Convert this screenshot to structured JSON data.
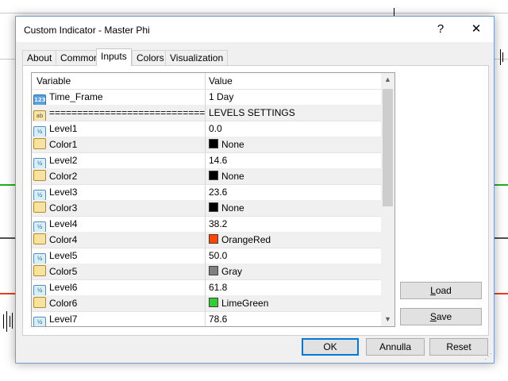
{
  "window": {
    "title": "Custom Indicator - Master Phi",
    "help_glyph": "?",
    "close_glyph": "✕",
    "accent": "#7a9cc6"
  },
  "tabs": [
    {
      "label": "About",
      "active": false
    },
    {
      "label": "Common",
      "active": false
    },
    {
      "label": "Inputs",
      "active": true
    },
    {
      "label": "Colors",
      "active": false
    },
    {
      "label": "Visualization",
      "active": false
    }
  ],
  "grid": {
    "col_variable": "Variable",
    "col_value": "Value",
    "rows": [
      {
        "icon": "int-icon",
        "glyph": "123",
        "variable": "Time_Frame",
        "value": "1 Day"
      },
      {
        "icon": "string-icon",
        "glyph": "ab",
        "variable": "================================",
        "value": "LEVELS SETTINGS"
      },
      {
        "icon": "double-icon",
        "glyph": "½",
        "variable": "Level1",
        "value": "0.0"
      },
      {
        "icon": "color-icon",
        "glyph": "",
        "variable": "Color1",
        "value": "None",
        "swatch": "#000000"
      },
      {
        "icon": "double-icon",
        "glyph": "½",
        "variable": "Level2",
        "value": "14.6"
      },
      {
        "icon": "color-icon",
        "glyph": "",
        "variable": "Color2",
        "value": "None",
        "swatch": "#000000"
      },
      {
        "icon": "double-icon",
        "glyph": "½",
        "variable": "Level3",
        "value": "23.6"
      },
      {
        "icon": "color-icon",
        "glyph": "",
        "variable": "Color3",
        "value": "None",
        "swatch": "#000000"
      },
      {
        "icon": "double-icon",
        "glyph": "½",
        "variable": "Level4",
        "value": "38.2"
      },
      {
        "icon": "color-icon",
        "glyph": "",
        "variable": "Color4",
        "value": "OrangeRed",
        "swatch": "#ff4500"
      },
      {
        "icon": "double-icon",
        "glyph": "½",
        "variable": "Level5",
        "value": "50.0"
      },
      {
        "icon": "color-icon",
        "glyph": "",
        "variable": "Color5",
        "value": "Gray",
        "swatch": "#808080"
      },
      {
        "icon": "double-icon",
        "glyph": "½",
        "variable": "Level6",
        "value": "61.8"
      },
      {
        "icon": "color-icon",
        "glyph": "",
        "variable": "Color6",
        "value": "LimeGreen",
        "swatch": "#32cd32"
      },
      {
        "icon": "double-icon",
        "glyph": "½",
        "variable": "Level7",
        "value": "78.6"
      }
    ],
    "scroll_up": "▲",
    "scroll_down": "▼"
  },
  "side_buttons": {
    "load_label": "Load",
    "load_mnemonic": "L",
    "load_rest": "oad",
    "save_label": "Save",
    "save_mnemonic": "S",
    "save_rest": "ave"
  },
  "footer_buttons": {
    "ok_label": "OK",
    "cancel_label": "Annulla",
    "reset_label": "Reset"
  },
  "background_lines": {
    "green": "#1db21d",
    "gray": "#505050",
    "red": "#e8401c"
  }
}
